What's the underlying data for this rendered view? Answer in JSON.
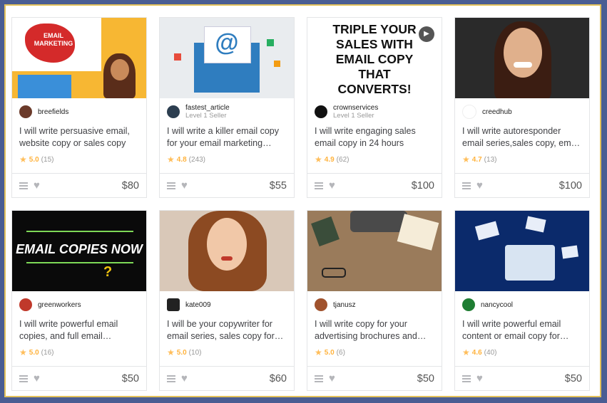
{
  "gigs": [
    {
      "seller": "breefields",
      "level": "",
      "title": "I will write persuasive email, website copy or sales copy",
      "rating": "5.0",
      "count": "(15)",
      "price": "$80",
      "avatar_color": "#6b3a2a",
      "thumb": "email-marketing-illustration",
      "thumb_text": "EMAIL MARKETING"
    },
    {
      "seller": "fastest_article",
      "level": "Level 1 Seller",
      "title": "I will write a killer email copy for your email marketing…",
      "rating": "4.8",
      "count": "(243)",
      "price": "$55",
      "avatar_color": "#2c3e50",
      "thumb": "envelope-illustration",
      "thumb_text": "@"
    },
    {
      "seller": "crownservices",
      "level": "Level 1 Seller",
      "title": "I will write engaging sales email copy in 24 hours",
      "rating": "4.9",
      "count": "(62)",
      "price": "$100",
      "avatar_color": "#111111",
      "thumb": "text-poster",
      "thumb_text": "TRIPLE YOUR SALES WITH EMAIL COPY THAT CONVERTS!"
    },
    {
      "seller": "creedhub",
      "level": "",
      "title": "I will write autoresponder email series,sales copy, em…",
      "rating": "4.7",
      "count": "(13)",
      "price": "$100",
      "avatar_color": "#dddddd",
      "thumb": "woman-portrait",
      "thumb_text": ""
    },
    {
      "seller": "greenworkers",
      "level": "",
      "title": "I will write powerful email copies, and full email…",
      "rating": "5.0",
      "count": "(16)",
      "price": "$50",
      "avatar_color": "#c0392b",
      "thumb": "email-copies-poster",
      "thumb_text": "EMAIL COPIES NOW"
    },
    {
      "seller": "kate009",
      "level": "",
      "title": "I will be your copywriter for email series, sales copy for…",
      "rating": "5.0",
      "count": "(10)",
      "price": "$60",
      "avatar_color": "#222222",
      "thumb": "woman-portrait",
      "thumb_text": ""
    },
    {
      "seller": "tjanusz",
      "level": "",
      "title": "I will write copy for your advertising brochures and…",
      "rating": "5.0",
      "count": "(6)",
      "price": "$50",
      "avatar_color": "#a0522d",
      "thumb": "typewriter-desk",
      "thumb_text": ""
    },
    {
      "seller": "nancycool",
      "level": "",
      "title": "I will write powerful email content or email copy for…",
      "rating": "4.6",
      "count": "(40)",
      "price": "$50",
      "avatar_color": "#1e7d32",
      "thumb": "blue-mailbox",
      "thumb_text": ""
    }
  ]
}
